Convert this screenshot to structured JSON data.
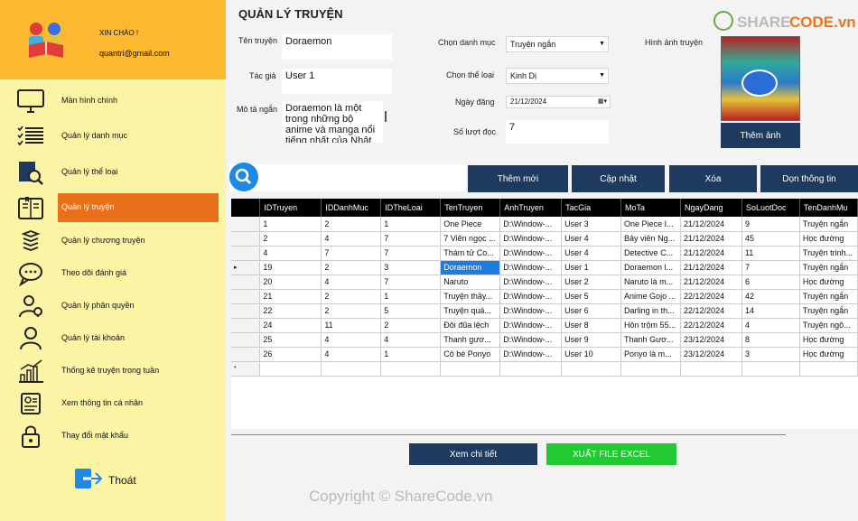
{
  "sidebar": {
    "greeting": "XIN CHÀO !",
    "email": "quantri@gmail.com",
    "items": [
      {
        "label": "Màn hình chính",
        "icon": "monitor-icon"
      },
      {
        "label": "Quản lý danh mục",
        "icon": "checklist-icon"
      },
      {
        "label": "Quản lý thể loại",
        "icon": "book-search-icon"
      },
      {
        "label": "Quản lý truyện",
        "icon": "book-open-icon"
      },
      {
        "label": "Quản lý chương truyện",
        "icon": "stack-icon"
      },
      {
        "label": "Theo dõi đánh giá",
        "icon": "chat-icon"
      },
      {
        "label": "Quản lý phân quyền",
        "icon": "user-gear-icon"
      },
      {
        "label": "Quản lý tài khoản",
        "icon": "user-icon"
      },
      {
        "label": "Thống kê truyện trong tuần",
        "icon": "bar-chart-icon"
      },
      {
        "label": "Xem thông tin cá nhân",
        "icon": "id-card-icon"
      },
      {
        "label": "Thay đổi mật khẩu",
        "icon": "lock-icon"
      }
    ],
    "logout": "Thoát"
  },
  "form": {
    "title": "QUẢN LÝ TRUYỆN",
    "ten_truyen_label": "Tên truyện",
    "ten_truyen_value": "Doraemon",
    "tac_gia_label": "Tác giả",
    "tac_gia_value": "User 1",
    "mo_ta_label": "Mô tả ngắn",
    "mo_ta_value": "Doraemon là một trong những bộ anime và manga nổi tiếng nhất của Nhật Bản",
    "danh_muc_label": "Chọn danh mục",
    "danh_muc_value": "Truyện ngắn",
    "the_loai_label": "Chọn thể loại",
    "the_loai_value": "Kinh Dị",
    "ngay_dang_label": "Ngày đăng",
    "ngay_dang_value": "21/12/2024",
    "so_luot_doc_label": "Số lượt đọc",
    "so_luot_doc_value": "7",
    "hinh_anh_label": "Hình ảnh truyện",
    "them_anh": "Thêm ảnh"
  },
  "toolbar": {
    "add": "Thêm mới",
    "update": "Cập nhật",
    "delete": "Xóa",
    "clear": "Dọn thông tin"
  },
  "grid": {
    "columns": [
      "IDTruyen",
      "IDDanhMuc",
      "IDTheLoai",
      "TenTruyen",
      "AnhTruyen",
      "TacGia",
      "MoTa",
      "NgayDang",
      "SoLuotDoc",
      "TenDanhMu"
    ],
    "rows": [
      [
        "1",
        "2",
        "1",
        "One Piece",
        "D:\\Window-...",
        "User 3",
        "One Piece I...",
        "21/12/2024",
        "9",
        "Truyện ngắn"
      ],
      [
        "2",
        "4",
        "7",
        "7 Viên ngọc ...",
        "D:\\Window-...",
        "User 4",
        "Bảy viên Ng...",
        "21/12/2024",
        "45",
        "Học đường"
      ],
      [
        "4",
        "7",
        "7",
        "Thám tử Co...",
        "D:\\Window-...",
        "User 4",
        "Detective C...",
        "21/12/2024",
        "11",
        "Truyện trinh..."
      ],
      [
        "19",
        "2",
        "3",
        "Doraemon",
        "D:\\Window-...",
        "User 1",
        "Doraemon l...",
        "21/12/2024",
        "7",
        "Truyện ngắn"
      ],
      [
        "20",
        "4",
        "7",
        "Naruto",
        "D:\\Window-...",
        "User 2",
        "Naruto là m...",
        "21/12/2024",
        "6",
        "Học đường"
      ],
      [
        "21",
        "2",
        "1",
        "Truyện thầy...",
        "D:\\Window-...",
        "User 5",
        "Anime Gojo ...",
        "22/12/2024",
        "42",
        "Truyện ngắn"
      ],
      [
        "22",
        "2",
        "5",
        "Truyện quá...",
        "D:\\Window-...",
        "User 6",
        "Darling in th...",
        "22/12/2024",
        "14",
        "Truyện ngắn"
      ],
      [
        "24",
        "11",
        "2",
        "Đôi đũa lệch",
        "D:\\Window-...",
        "User 8",
        "Hôn trộm 55...",
        "22/12/2024",
        "4",
        "Truyện ngô..."
      ],
      [
        "25",
        "4",
        "4",
        "Thanh gươ...",
        "D:\\Window-...",
        "User 9",
        "Thanh Gươ...",
        "23/12/2024",
        "8",
        "Học đường"
      ],
      [
        "26",
        "4",
        "1",
        "Cô bé Ponyo",
        "D:\\Window-...",
        "User 10",
        "Ponyo là m...",
        "23/12/2024",
        "3",
        "Học đường"
      ]
    ],
    "new_row_marker": "*",
    "current_row_marker": "▸"
  },
  "bottom": {
    "detail": "Xem chi tiết",
    "excel": "XUẤT FILE EXCEL"
  },
  "watermark": {
    "copyright": "Copyright © ShareCode.vn",
    "brand_share": "SHARE",
    "brand_code": "CODE.vn"
  },
  "colors": {
    "sidebar_bg": "#fbf4a5",
    "header_bg": "#fbb830",
    "active_item": "#e9701a",
    "button_dark": "#1e3a5f",
    "excel_green": "#22c933",
    "selected_cell": "#1e7be0"
  }
}
